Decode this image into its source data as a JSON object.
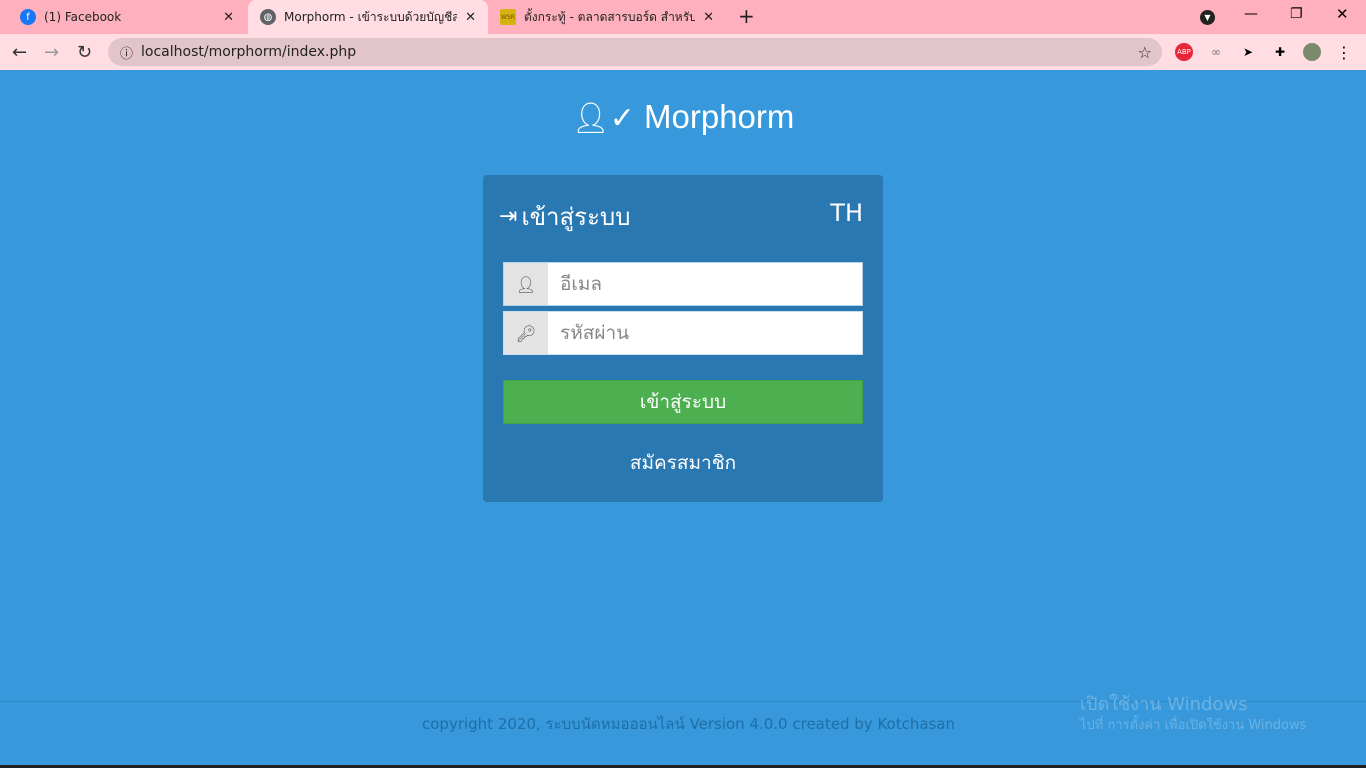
{
  "browser": {
    "tabs": [
      {
        "title": "(1) Facebook",
        "icon": "facebook-icon"
      },
      {
        "title": "Morphorm - เข้าระบบด้วยบัญชีสมาชิก",
        "icon": "globe-icon",
        "active": true
      },
      {
        "title": "ตั้งกระทู้ - ตลาดสารบอร์ด สำหรับติดต่อสื่อสาร",
        "icon": "wsr-icon",
        "icon_text": "WSR"
      }
    ],
    "new_tab": "+",
    "url": "localhost/morphorm/index.php"
  },
  "app": {
    "name": "Morphorm"
  },
  "login": {
    "title": "เข้าสู่ระบบ",
    "language": "TH",
    "email_placeholder": "อีเมล",
    "email_value": "",
    "password_placeholder": "รหัสผ่าน",
    "password_value": "",
    "submit_label": "เข้าสู่ระบบ",
    "register_label": "สมัครสมาชิก"
  },
  "footer": {
    "copyright": "copyright 2020, ระบบนัดหมอออนไลน์ Version 4.0.0 created by Kotchasan"
  },
  "watermark": {
    "line1": "เปิดใช้งาน Windows",
    "line2": "ไปที่ การตั้งค่า เพื่อเปิดใช้งาน Windows"
  },
  "colors": {
    "page_bg": "#3798db",
    "card_bg": "#2a78b2",
    "button": "#4caf50"
  }
}
